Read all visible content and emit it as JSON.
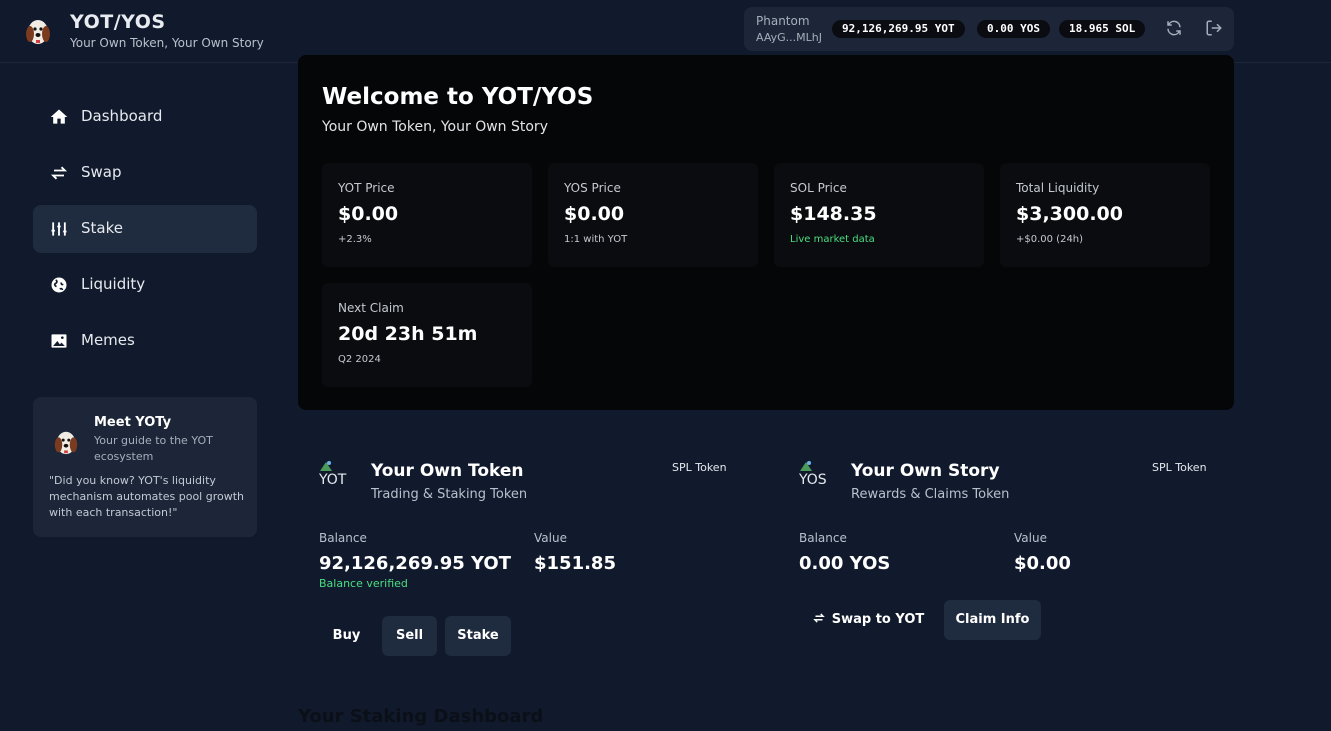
{
  "header": {
    "title": "YOT/YOS",
    "subtitle": "Your Own Token, Your Own Story",
    "wallet": {
      "name": "Phantom",
      "address": "AAyG...MLhJ",
      "balances": [
        "92,126,269.95 YOT",
        "0.00 YOS",
        "18.965 SOL"
      ]
    },
    "icons": [
      "refresh-icon",
      "logout-icon"
    ]
  },
  "sidebar": {
    "items": [
      {
        "label": "Dashboard",
        "icon": "home-icon"
      },
      {
        "label": "Swap",
        "icon": "swap-arrows-icon"
      },
      {
        "label": "Stake",
        "icon": "sliders-icon"
      },
      {
        "label": "Liquidity",
        "icon": "globe-icon"
      },
      {
        "label": "Memes",
        "icon": "image-icon"
      }
    ],
    "active": "Stake",
    "meet": {
      "title": "Meet YOTy",
      "description": "Your guide to the YOT ecosystem",
      "quote": "\"Did you know? YOT's liquidity mechanism automates pool growth with each transaction!\""
    }
  },
  "welcome": {
    "title": "Welcome to YOT/YOS",
    "subtitle": "Your Own Token, Your Own Story",
    "stats": [
      {
        "label": "YOT Price",
        "value": "$0.00",
        "note": "+2.3%"
      },
      {
        "label": "YOS Price",
        "value": "$0.00",
        "note": "1:1 with YOT"
      },
      {
        "label": "SOL Price",
        "value": "$148.35",
        "note": "Live market data"
      },
      {
        "label": "Total Liquidity",
        "value": "$3,300.00",
        "note": "+$0.00 (24h)"
      },
      {
        "label": "Next Claim",
        "value": "20d 23h 51m",
        "note": "Q2 2024"
      }
    ]
  },
  "tokens": [
    {
      "logo_alt": "YOT",
      "title": "Your Own Token",
      "subtitle": "Trading & Staking Token",
      "tag": "SPL Token",
      "balance_label": "Balance",
      "balance": "92,126,269.95 YOT",
      "verified": "Balance verified",
      "value_label": "Value",
      "value": "$151.85",
      "buttons": [
        "Buy",
        "Sell",
        "Stake"
      ]
    },
    {
      "logo_alt": "YOS",
      "title": "Your Own Story",
      "subtitle": "Rewards & Claims Token",
      "tag": "SPL Token",
      "balance_label": "Balance",
      "balance": "0.00 YOS",
      "value_label": "Value",
      "value": "$0.00",
      "buttons": [
        "Swap to YOT",
        "Claim Info"
      ]
    }
  ],
  "staking": {
    "heading": "Your Staking Dashboard"
  },
  "colors": {
    "background": "#111a2c",
    "panel": "#050607",
    "card": "#1c2638",
    "positive": "#4ade80"
  }
}
